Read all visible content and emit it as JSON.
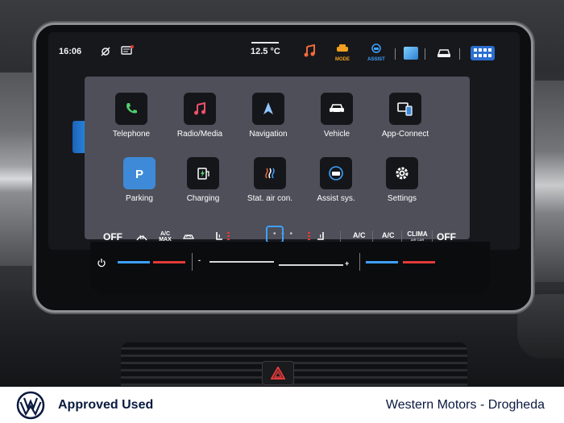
{
  "statusbar": {
    "time": "16:06",
    "temperature": "12.5 °C",
    "mode_label": "MODE",
    "assist_label": "ASSIST"
  },
  "apps": [
    {
      "label": "Telephone",
      "icon": "phone-icon"
    },
    {
      "label": "Radio/Media",
      "icon": "music-note-icon"
    },
    {
      "label": "Navigation",
      "icon": "navigation-arrow-icon"
    },
    {
      "label": "Vehicle",
      "icon": "car-icon"
    },
    {
      "label": "App-Connect",
      "icon": "app-connect-icon"
    },
    {
      "label": "Parking",
      "icon": "parking-icon"
    },
    {
      "label": "Charging",
      "icon": "charging-icon"
    },
    {
      "label": "Stat. air con.",
      "icon": "stationary-aircon-icon"
    },
    {
      "label": "Assist sys.",
      "icon": "assist-systems-icon"
    },
    {
      "label": "Settings",
      "icon": "gear-icon"
    }
  ],
  "page_dots": "• • •",
  "climatebar": {
    "off_left": "OFF",
    "ac_max_top": "A/C",
    "ac_max_bottom": "MAX",
    "ac_1": "A/C",
    "ac_2": "A/C",
    "clima_top": "CLIMA",
    "clima_bottom": "AIR CAR",
    "off_right": "OFF"
  },
  "touchstrip": {
    "minus": "-",
    "plus": "+"
  },
  "footer": {
    "brand_text": "Approved Used",
    "dealer_text": "Western Motors - Drogheda"
  },
  "colors": {
    "accent_blue": "#3ea0ff",
    "alert_red": "#e23a3a",
    "status_orange": "#f0a020",
    "brand_navy": "#0a1a3f"
  }
}
